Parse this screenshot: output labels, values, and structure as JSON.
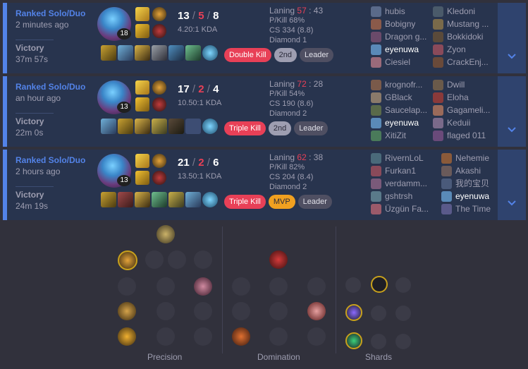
{
  "matches": [
    {
      "queue": "Ranked Solo/Duo",
      "ago": "2 minutes ago",
      "result": "Victory",
      "duration": "37m 57s",
      "level": "18",
      "kills": "13",
      "deaths": "5",
      "assists": "8",
      "kda": "4.20:1 KDA",
      "badges": [
        "Double Kill",
        "2nd",
        "Leader"
      ],
      "laning_label": "Laning",
      "laning_a": "57",
      "laning_b": "43",
      "pkill": "P/Kill 68%",
      "cs": "CS 334 (8.8)",
      "rank": "Diamond 1",
      "team1": [
        "hubis",
        "Bobigny",
        "Dragon g...",
        "eyenuwa",
        "Ciesiel"
      ],
      "team2": [
        "Kledoni",
        "Mustang ...",
        "Bokkidoki",
        "Zyon",
        "CrackEnj..."
      ]
    },
    {
      "queue": "Ranked Solo/Duo",
      "ago": "an hour ago",
      "result": "Victory",
      "duration": "22m 0s",
      "level": "13",
      "kills": "17",
      "deaths": "2",
      "assists": "4",
      "kda": "10.50:1 KDA",
      "badges": [
        "Triple Kill",
        "2nd",
        "Leader"
      ],
      "laning_label": "Laning",
      "laning_a": "72",
      "laning_b": "28",
      "pkill": "P/Kill 54%",
      "cs": "CS 190 (8.6)",
      "rank": "Diamond 2",
      "team1": [
        "krognofr...",
        "GBlack",
        "Saucelap...",
        "eyenuwa",
        "XitiZit"
      ],
      "team2": [
        "Dwill",
        "Eloha",
        "Gagameli...",
        "Keduii",
        "flaged 011"
      ]
    },
    {
      "queue": "Ranked Solo/Duo",
      "ago": "2 hours ago",
      "result": "Victory",
      "duration": "24m 19s",
      "level": "13",
      "kills": "21",
      "deaths": "2",
      "assists": "6",
      "kda": "13.50:1 KDA",
      "badges": [
        "Triple Kill",
        "MVP",
        "Leader"
      ],
      "laning_label": "Laning",
      "laning_a": "62",
      "laning_b": "38",
      "pkill": "P/Kill 82%",
      "cs": "CS 204 (8.4)",
      "rank": "Diamond 2",
      "team1": [
        "RivernLoL",
        "Furkan1",
        "verdamm...",
        "gshtrsh",
        "Üzgün Fa..."
      ],
      "team2": [
        "Nehemie",
        "Akashi",
        "我的宝贝",
        "eyenuwa",
        "The Time"
      ]
    }
  ],
  "runes": {
    "precision_label": "Precision",
    "domination_label": "Domination",
    "shards_label": "Shards"
  },
  "colors": {
    "accent": "#5383e8",
    "victory_bg": "#28344e",
    "red": "#e84057",
    "gold": "#c8a11c"
  },
  "icons": {
    "expand": "chevron-down-icon"
  }
}
